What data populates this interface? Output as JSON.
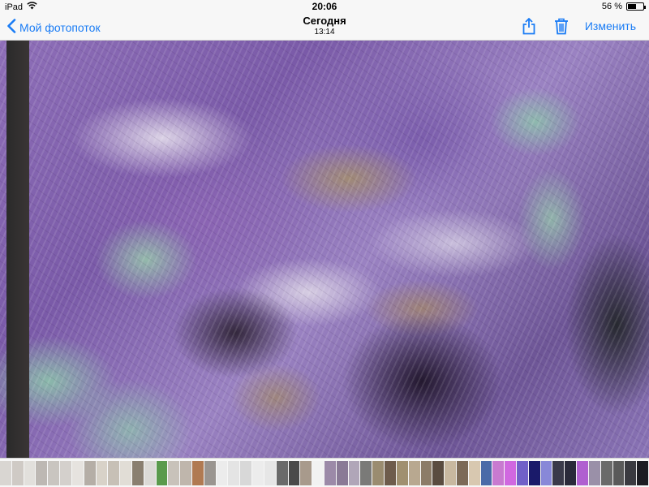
{
  "status_bar": {
    "device": "iPad",
    "time": "20:06",
    "battery": "56 %",
    "battery_level": 0.56
  },
  "nav": {
    "back_label": "Мой фотопоток",
    "title": "Сегодня",
    "subtitle": "13:14",
    "edit_label": "Изменить",
    "accent_color": "#1a7cf5"
  },
  "icons": {
    "back": "chevron-left-icon",
    "share": "share-icon",
    "delete": "trash-icon",
    "wifi": "wifi-icon",
    "battery": "battery-icon"
  },
  "thumbnails": {
    "colors": [
      "#d9d6d2",
      "#cfcac5",
      "#e2e0dc",
      "#bdb8b3",
      "#c9c5c0",
      "#d4d0cc",
      "#e6e3df",
      "#b5aea6",
      "#d8d2c8",
      "#c7c0b6",
      "#e1ddd6",
      "#8a7f70",
      "#dcdad6",
      "#5a9a4c",
      "#c8c2ba",
      "#bfb6ac",
      "#b07a52",
      "#9a9590",
      "#ececec",
      "#e4e4e4",
      "#d8d8d8",
      "#ececec",
      "#e6e6e6",
      "#6a6a6a",
      "#4a4a4a",
      "#a89a8c",
      "#f2f2f2",
      "#9c8aa8",
      "#8a7a96",
      "#b0a6b8",
      "#7a7a78",
      "#9a8c70",
      "#6e5c4c",
      "#a09070",
      "#b8a890",
      "#8c7c68",
      "#5a4c40",
      "#c8b8a0",
      "#7c6a58",
      "#d8c8b0",
      "#4a6aa8",
      "#c87ad0",
      "#d068e0",
      "#7060c8",
      "#1a1a6a",
      "#8888d8",
      "#3a3a4a",
      "#2a2a3a",
      "#b060d0",
      "#9a90a8",
      "#6a6a6a",
      "#5a5a5a",
      "#3a3a40",
      "#1c1c22"
    ]
  }
}
